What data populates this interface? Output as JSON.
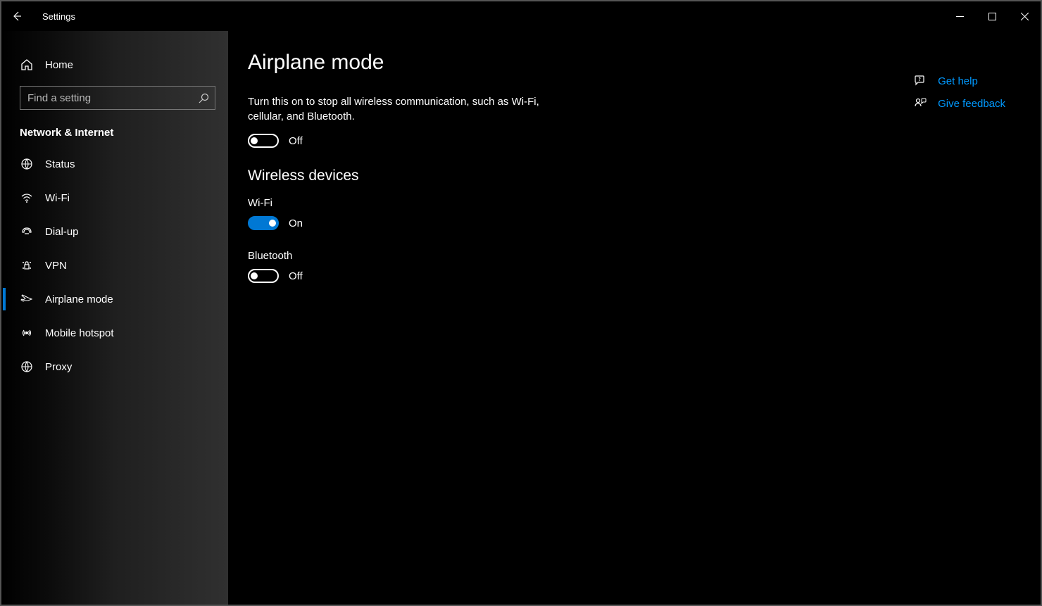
{
  "window": {
    "title": "Settings"
  },
  "sidebar": {
    "home": "Home",
    "search_placeholder": "Find a setting",
    "category": "Network & Internet",
    "items": [
      {
        "label": "Status"
      },
      {
        "label": "Wi-Fi"
      },
      {
        "label": "Dial-up"
      },
      {
        "label": "VPN"
      },
      {
        "label": "Airplane mode"
      },
      {
        "label": "Mobile hotspot"
      },
      {
        "label": "Proxy"
      }
    ]
  },
  "main": {
    "title": "Airplane mode",
    "description": "Turn this on to stop all wireless communication, such as Wi-Fi, cellular, and Bluetooth.",
    "airplane_state": "Off",
    "wireless_header": "Wireless devices",
    "wifi": {
      "name": "Wi-Fi",
      "state": "On"
    },
    "bluetooth": {
      "name": "Bluetooth",
      "state": "Off"
    }
  },
  "links": {
    "help": "Get help",
    "feedback": "Give feedback"
  }
}
